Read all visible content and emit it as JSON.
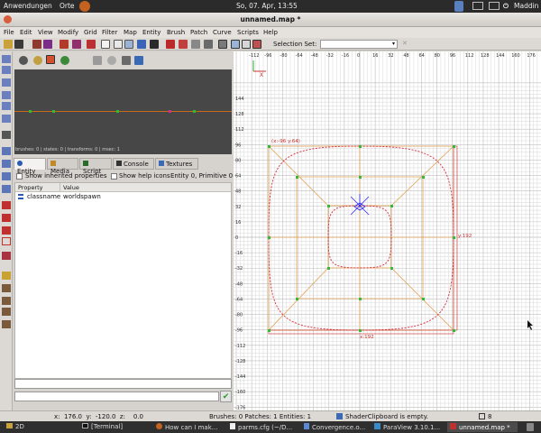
{
  "gnome_panel": {
    "applications": "Anwendungen",
    "places": "Orte",
    "clock": "So, 07. Apr, 13:55",
    "user": "Maddin"
  },
  "window": {
    "title": "unnamed.map *"
  },
  "menu": [
    "File",
    "Edit",
    "View",
    "Modify",
    "Grid",
    "Filter",
    "Map",
    "Entity",
    "Brush",
    "Patch",
    "Curve",
    "Scripts",
    "Help"
  ],
  "toolbar": {
    "selection_set_label": "Selection Set:",
    "selection_set_value": ""
  },
  "camera": {
    "status": "brushes: 0 | states: 0 | transforms: 0 | msec: 1"
  },
  "tabs": [
    "Entity",
    "Media",
    "Script",
    "Console",
    "Textures"
  ],
  "entity": {
    "show_inherited": "Show inherited properties",
    "show_help": "Show help icons",
    "summary": "Entity 0, Primitive 0",
    "col_property": "Property",
    "col_value": "Value",
    "rows": [
      {
        "property": "classname",
        "value": "worldspawn"
      }
    ],
    "key_input": "",
    "value_input": ""
  },
  "grid": {
    "top_labels": [
      "-112",
      "-96",
      "-80",
      "-64",
      "-48",
      "-32",
      "-16",
      "0",
      "16",
      "32",
      "48",
      "64",
      "80",
      "96",
      "112",
      "128",
      "144",
      "160",
      "176"
    ],
    "left_labels": [
      "144",
      "128",
      "112",
      "96",
      "80",
      "64",
      "48",
      "32",
      "16",
      "0",
      "-16",
      "-32",
      "-48",
      "-64",
      "-80",
      "-96",
      "-112",
      "-128",
      "-144",
      "-160",
      "-176",
      "-192",
      "-208"
    ],
    "corner_label": "(x:-96  y:64)",
    "width_label": "x:192",
    "height_label": "y:192"
  },
  "status": {
    "coords": "x:  176.0  y:  -120.0  z:    0.0",
    "counts": "Brushes: 0 Patches: 1 Entities: 1",
    "shader": "ShaderClipboard is empty.",
    "grid_size": "8"
  },
  "taskbar": [
    "2D",
    "[Terminal]",
    "How can I mak...",
    "parms.cfg (~/D...",
    "Convergence.o...",
    "ParaView 3.10.1...",
    "unnamed.map *"
  ]
}
